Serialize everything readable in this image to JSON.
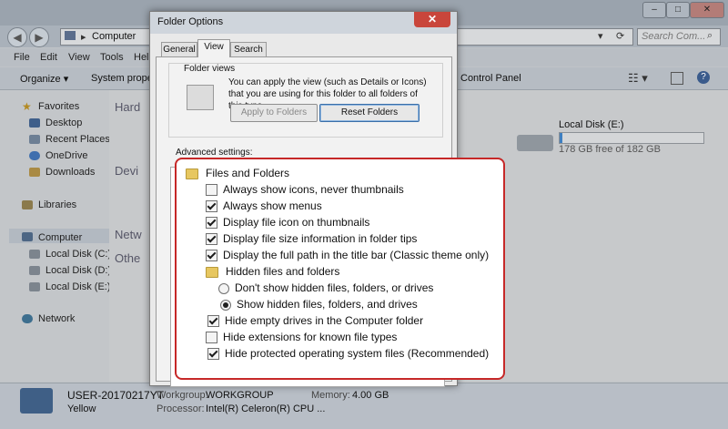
{
  "window": {
    "title_controls": [
      "–",
      "□",
      "✕"
    ],
    "address": {
      "path": "Computer",
      "sep": "▸"
    },
    "search": {
      "placeholder": "Search Com..."
    },
    "menu": [
      "File",
      "Edit",
      "View",
      "Tools",
      "Hel"
    ],
    "toolbar": {
      "organize": "Organize ▾",
      "system_properties": "System proper",
      "control_panel": "Control Panel"
    },
    "nav": {
      "favorites": "Favorites",
      "desktop": "Desktop",
      "recent_places": "Recent Places",
      "onedrive": "OneDrive",
      "downloads": "Downloads",
      "libraries": "Libraries",
      "computer": "Computer",
      "disk_c": "Local Disk (C:)",
      "disk_d": "Local Disk (D:)",
      "disk_e": "Local Disk (E:)",
      "network": "Network"
    },
    "content": {
      "section_hard": "Hard",
      "section_devices": "Devi",
      "section_network": "Netw",
      "section_other": "Othe",
      "drive_e_name": "Local Disk (E:)",
      "drive_e_free": "178 GB free of 182 GB",
      "drive_e_used_fraction": 0.02
    },
    "details": {
      "computer_name": "USER-20170217YT",
      "workgroup_label": "Workgroup:",
      "workgroup_value": "WORKGROUP",
      "memory_label": "Memory:",
      "memory_value": "4.00 GB",
      "processor_label": "Processor:",
      "processor_value": "Intel(R) Celeron(R) CPU ...",
      "yellow": "Yellow"
    }
  },
  "dialog": {
    "title": "Folder Options",
    "close": "✕",
    "tabs": [
      "General",
      "View",
      "Search"
    ],
    "folder_views": {
      "label": "Folder views",
      "description": "You can apply the view (such as Details or Icons) that you are using for this folder to all folders of this type.",
      "apply_button": "Apply to Folders",
      "reset_button": "Reset Folders"
    },
    "advanced_label": "Advanced settings:"
  },
  "advanced_settings": [
    {
      "kind": "folder",
      "label": "Files and Folders",
      "indent": 0
    },
    {
      "kind": "checkbox",
      "label": "Always show icons, never thumbnails",
      "checked": false,
      "indent": 1,
      "highlight": false
    },
    {
      "kind": "checkbox",
      "label": "Always show menus",
      "checked": true,
      "indent": 1,
      "highlight": false
    },
    {
      "kind": "checkbox",
      "label": "Display file icon on thumbnails",
      "checked": true,
      "indent": 1,
      "highlight": false
    },
    {
      "kind": "checkbox",
      "label": "Display file size information in folder tips",
      "checked": true,
      "indent": 1,
      "highlight": false
    },
    {
      "kind": "checkbox",
      "label": "Display the full path in the title bar (Classic theme only)",
      "checked": true,
      "indent": 1,
      "highlight": false
    },
    {
      "kind": "folder",
      "label": "Hidden files and folders",
      "indent": 1
    },
    {
      "kind": "radio",
      "label": "Don't show hidden files, folders, or drives",
      "checked": false,
      "indent": 2,
      "highlight": false
    },
    {
      "kind": "radio",
      "label": "Show hidden files, folders, and drives",
      "checked": true,
      "indent": 2,
      "highlight": true
    },
    {
      "kind": "checkbox",
      "label": "Hide empty drives in the Computer folder",
      "checked": true,
      "indent": 1,
      "highlight": true
    },
    {
      "kind": "checkbox",
      "label": "Hide extensions for known file types",
      "checked": false,
      "indent": 1,
      "highlight": false
    },
    {
      "kind": "checkbox",
      "label": "Hide protected operating system files (Recommended)",
      "checked": true,
      "indent": 1,
      "highlight": true
    }
  ],
  "colors": {
    "highlight_border": "#c62828",
    "dim_overlay": "#8a8a8a"
  }
}
